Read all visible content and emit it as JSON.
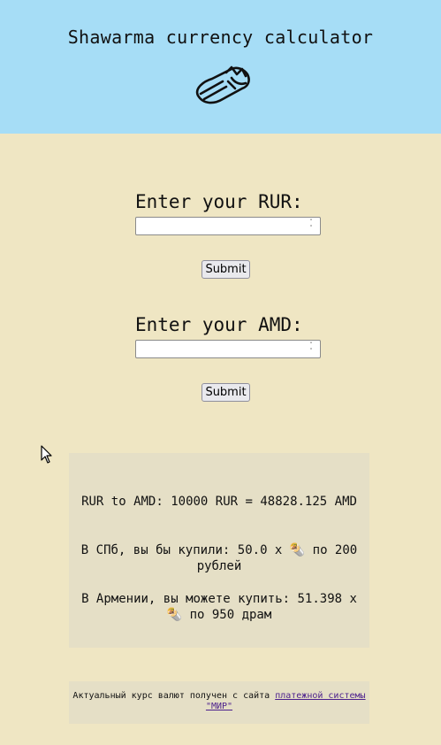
{
  "header": {
    "title": "Shawarma currency calculator",
    "logo_icon": "shawarma-icon"
  },
  "rur_form": {
    "label": "Enter your RUR:",
    "value": "",
    "submit_label": "Submit"
  },
  "amd_form": {
    "label": "Enter your AMD:",
    "value": "",
    "submit_label": "Submit"
  },
  "results": {
    "line1": "RUR to AMD: 10000 RUR = 48828.125 AMD",
    "line2": "В СПб, вы бы купили: 50.0 x 🌯 по 200 рублей",
    "line3": "В Армении, вы можете купить: 51.398 x 🌯 по 950 драм"
  },
  "footer": {
    "text": "Актуальный курс валют получен с сайта ",
    "link_text": "платежной системы \"МИР\""
  },
  "colors": {
    "header_bg": "#a6ddf6",
    "page_bg": "#efe6c3",
    "panel_bg": "#e5dfc6",
    "link": "#4b1f8c"
  }
}
